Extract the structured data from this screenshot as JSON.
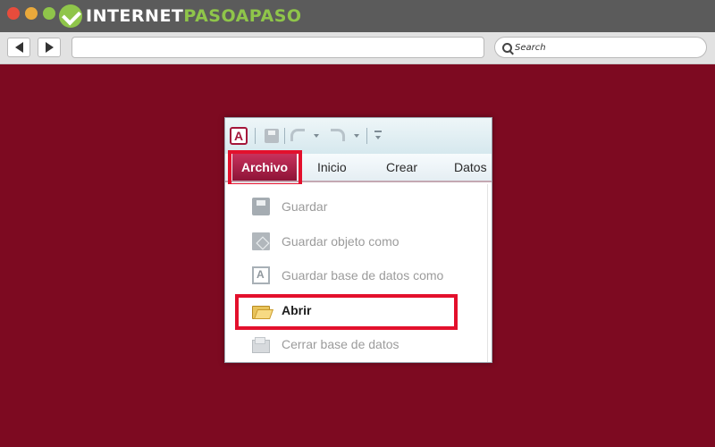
{
  "browser": {
    "logo": {
      "text_prefix": "INTERNET",
      "text_accent": "PASOAPASO"
    },
    "nav": {
      "back_icon": "chevron-left-icon",
      "forward_icon": "chevron-right-icon"
    },
    "address": {
      "value": ""
    },
    "search": {
      "label": "Search"
    }
  },
  "access": {
    "quick_access": {
      "app_icon_letter": "A",
      "icons": [
        "access-app-icon",
        "save-icon",
        "undo-icon",
        "redo-icon",
        "customize-toolbar-icon"
      ]
    },
    "tabs": [
      {
        "label": "Archivo",
        "active": true
      },
      {
        "label": "Inicio"
      },
      {
        "label": "Crear"
      },
      {
        "label": "Datos"
      }
    ],
    "file_menu": [
      {
        "label": "Guardar",
        "icon": "save-icon",
        "enabled": false
      },
      {
        "label": "Guardar objeto como",
        "icon": "save-object-icon",
        "enabled": false
      },
      {
        "label": "Guardar base de datos como",
        "icon": "save-database-icon",
        "enabled": false
      },
      {
        "label": "Abrir",
        "icon": "open-folder-icon",
        "enabled": true
      },
      {
        "label": "Cerrar base de datos",
        "icon": "close-database-icon",
        "enabled": false
      }
    ]
  },
  "colors": {
    "background": "#7d0a21",
    "highlight": "#e3102c",
    "archivo_tab": "#a81f47",
    "brand_green": "#8fc54a"
  }
}
